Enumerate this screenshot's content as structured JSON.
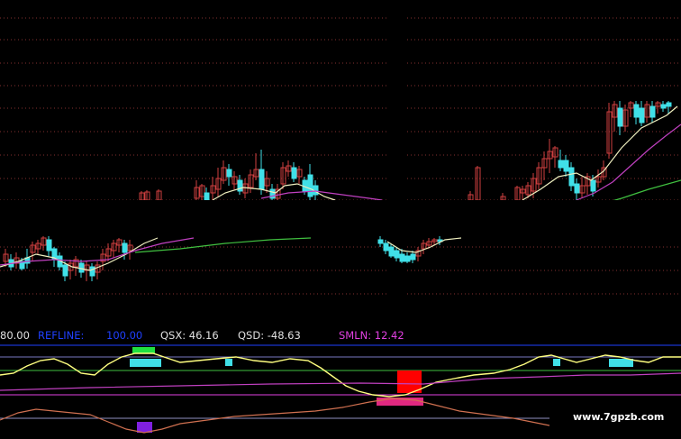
{
  "indicator_bar": {
    "first_value": "80.00",
    "refline_label": "REFLINE:",
    "refline_value": "100.00",
    "qsx": "QSX: 46.16",
    "qsd": "QSD: -48.63",
    "smln": "SMLN: 12.42"
  },
  "watermark": "www.7gpzb.com",
  "colors": {
    "background": "#000000",
    "up_candle": "#d04040",
    "down_candle": "#40e0e8",
    "ma_short": "#f0f0c0",
    "ma_mid": "#c040c0",
    "ma_long": "#40c040",
    "osc_yellow": "#ffff80",
    "refline_blue": "#2040ff",
    "green_line": "#40c040",
    "magenta_line": "#e040e0",
    "brown_line": "#d07050",
    "block_cyan": "#40e0e8",
    "block_green": "#20e040",
    "block_red": "#ff0000",
    "block_pink": "#e02880",
    "block_purple": "#8020e0"
  }
}
